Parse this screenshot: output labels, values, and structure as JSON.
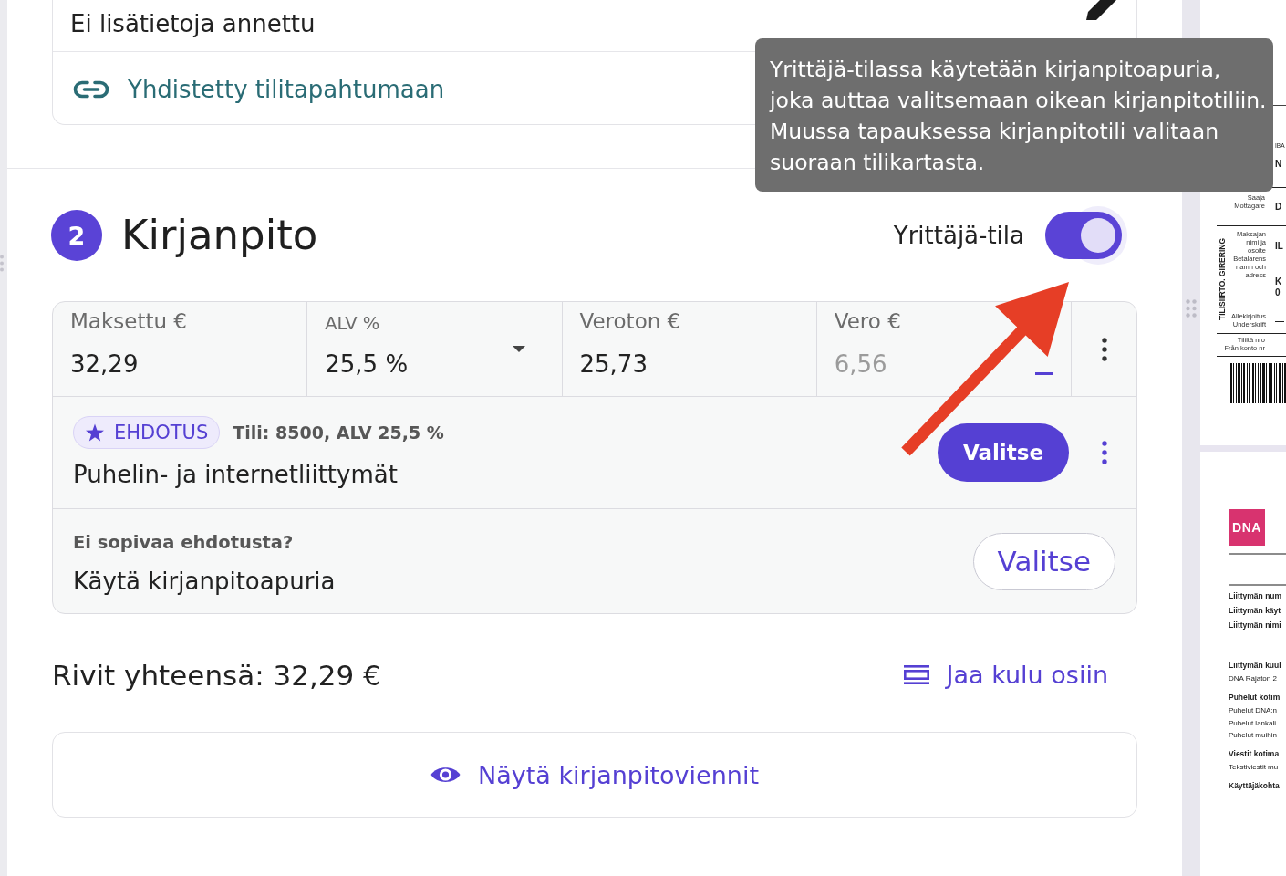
{
  "info_card": {
    "note": "Ei lisätietoja annettu",
    "link": "Yhdistetty tilitapahtumaan"
  },
  "section": {
    "number": "2",
    "title": "Kirjanpito",
    "mode_toggle": {
      "label": "Yrittäjä-tila",
      "on": true
    }
  },
  "tooltip": {
    "text": "Yrittäjä-tilassa käytetään kirjanpitoapuria, joka auttaa valitsemaan oikean kirjanpitotiliin. Muussa tapauksessa kirjanpitotili valitaan suoraan tilikartasta."
  },
  "fields": [
    {
      "kind": "text",
      "label": "Maksettu €",
      "value": "32,29"
    },
    {
      "kind": "select",
      "label": "ALV %",
      "value": "25,5 %"
    },
    {
      "kind": "text",
      "label": "Veroton €",
      "value": "25,73"
    },
    {
      "kind": "computed",
      "label": "Vero €",
      "placeholder": "6,56"
    }
  ],
  "suggestion": {
    "badge": "EHDOTUS",
    "account": "Tili: 8500, ALV 25,5 %",
    "name": "Puhelin- ja internetliittymät",
    "button": "Valitse"
  },
  "fallback": {
    "question": "Ei sopivaa ehdotusta?",
    "text": "Käytä kirjanpitoapuria",
    "button": "Valitse"
  },
  "total": "Rivit yhteensä: 32,29 €",
  "split_button": "Jaa kulu osiin",
  "show_entries_button": "Näytä kirjanpitoviennit",
  "document_preview": {
    "payment_slip": {
      "rows": [
        {
          "kind": "account",
          "caption": "IBA",
          "values": [
            "N"
          ]
        },
        {
          "kind": "recipient",
          "labels": [
            "Saaja",
            "Mottagare"
          ],
          "values": [
            "D"
          ]
        },
        {
          "kind": "payer",
          "side_title": "TILISIIRTO. GIRERING",
          "labels": [
            "Maksajan nimi ja osoite",
            "Betalarens namn och adress"
          ],
          "signature_labels": [
            "Allekirjoitus",
            "Underskrift"
          ],
          "values": [
            "IL",
            "K",
            "0"
          ]
        },
        {
          "kind": "from_account",
          "labels": [
            "Tililtä nro",
            "Från konto nr"
          ]
        }
      ]
    },
    "invoice_page": {
      "logo": "DNA",
      "groups": [
        {
          "lines": [
            {
              "kind": "heading",
              "text": "Liittymän num"
            },
            {
              "kind": "heading",
              "text": "Liittymän käyt"
            },
            {
              "kind": "heading",
              "text": "Liittymän nimi"
            }
          ]
        },
        {
          "lines": [
            {
              "kind": "heading",
              "text": "Liittymän kuul"
            },
            {
              "kind": "line",
              "text": "DNA Rajaton 2"
            }
          ]
        },
        {
          "lines": [
            {
              "kind": "heading",
              "text": "Puhelut kotim"
            },
            {
              "kind": "line",
              "text": "Puhelut DNA:n"
            },
            {
              "kind": "line",
              "text": "Puhelut lankali"
            },
            {
              "kind": "line",
              "text": "Puhelut muihin"
            }
          ]
        },
        {
          "lines": [
            {
              "kind": "heading",
              "text": "Viestit kotima"
            },
            {
              "kind": "line",
              "text": "Tekstiviestit mu"
            }
          ]
        },
        {
          "lines": [
            {
              "kind": "heading",
              "text": "Käyttäjäkohta"
            }
          ]
        }
      ]
    }
  }
}
